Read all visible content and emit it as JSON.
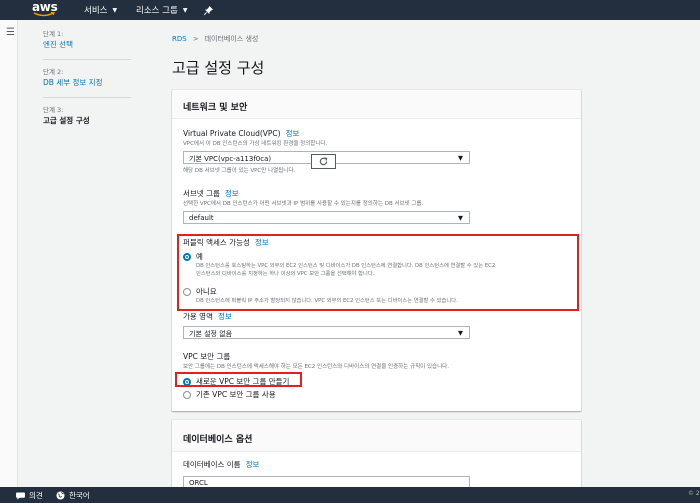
{
  "topnav": {
    "logo_text": "aws",
    "services_label": "서비스",
    "resource_groups_label": "리소스 그룹",
    "pin_icon": "pin-icon"
  },
  "steps": [
    {
      "num": "단계 1:",
      "label": "엔진 선택",
      "state": "link"
    },
    {
      "num": "단계 2:",
      "label": "DB 세부 정보 지정",
      "state": "link"
    },
    {
      "num": "단계 3:",
      "label": "고급 설정 구성",
      "state": "current"
    }
  ],
  "breadcrumb": {
    "root": "RDS",
    "separator": ">",
    "current": "데이터베이스 생성"
  },
  "page_title": "고급 설정 구성",
  "network_panel": {
    "title": "네트워크 및 보안",
    "vpc": {
      "label": "Virtual Private Cloud(VPC)",
      "info": "정보",
      "desc": "VPC에서 이 DB 인스턴스의 가상 네트워킹 환경을 정의합니다.",
      "value": "기본 VPC(vpc-a113f0ca)",
      "hint": "해당 DB 서브넷 그룹이 있는 VPC만 나열됩니다."
    },
    "subnet": {
      "label": "서브넷 그룹",
      "info": "정보",
      "desc": "선택한 VPC에서 DB 인스턴스가 어떤 서브넷과 IP 범위를 사용할 수 있는지를 정의하는 DB 서브넷 그룹.",
      "value": "default"
    },
    "public_access": {
      "label": "퍼블릭 액세스 가능성",
      "info": "정보",
      "options": [
        {
          "label": "예",
          "selected": true,
          "desc1": "DB 인스턴스를 호스팅하는 VPC 외부의 EC2 인스턴스 및 디바이스가 DB 인스턴스에 연결합니다. DB 인스턴스에 연결할 수 있는 EC2",
          "desc2": "인스턴스와 디바이스를 지정하는 하나 이상의 VPC 보안 그룹을 선택해야 합니다."
        },
        {
          "label": "아니요",
          "selected": false,
          "desc1": "DB 인스턴스에 퍼블릭 IP 주소가 할당되지 않습니다. VPC 외부의 EC2 인스턴스 또는 디바이스는 연결할 수 있습니다.",
          "desc2": ""
        }
      ]
    },
    "az": {
      "label": "가용 영역",
      "info": "정보",
      "value": "기본 설정 없음"
    },
    "sg": {
      "label": "VPC 보안 그룹",
      "desc": "보안 그룹에는 DB 인스턴스에 액세스해야 하는 모든 EC2 인스턴스와 디바이스의 연결을 인증하는 규칙이 있습니다.",
      "options": [
        {
          "label": "새로운 VPC 보안 그룹 만들기",
          "selected": true
        },
        {
          "label": "기존 VPC 보안 그룹 사용",
          "selected": false
        }
      ]
    }
  },
  "db_options_panel": {
    "title": "데이터베이스 옵션",
    "db_name": {
      "label": "데이터베이스 이름",
      "info": "정보",
      "value": "ORCL"
    }
  },
  "footer": {
    "feedback": "의견",
    "language": "한국어",
    "copyright": "© 2"
  },
  "colors": {
    "nav_bg": "#232f3e",
    "link": "#0073bb",
    "highlight": "#e0211e",
    "aws_orange": "#ff9900"
  }
}
